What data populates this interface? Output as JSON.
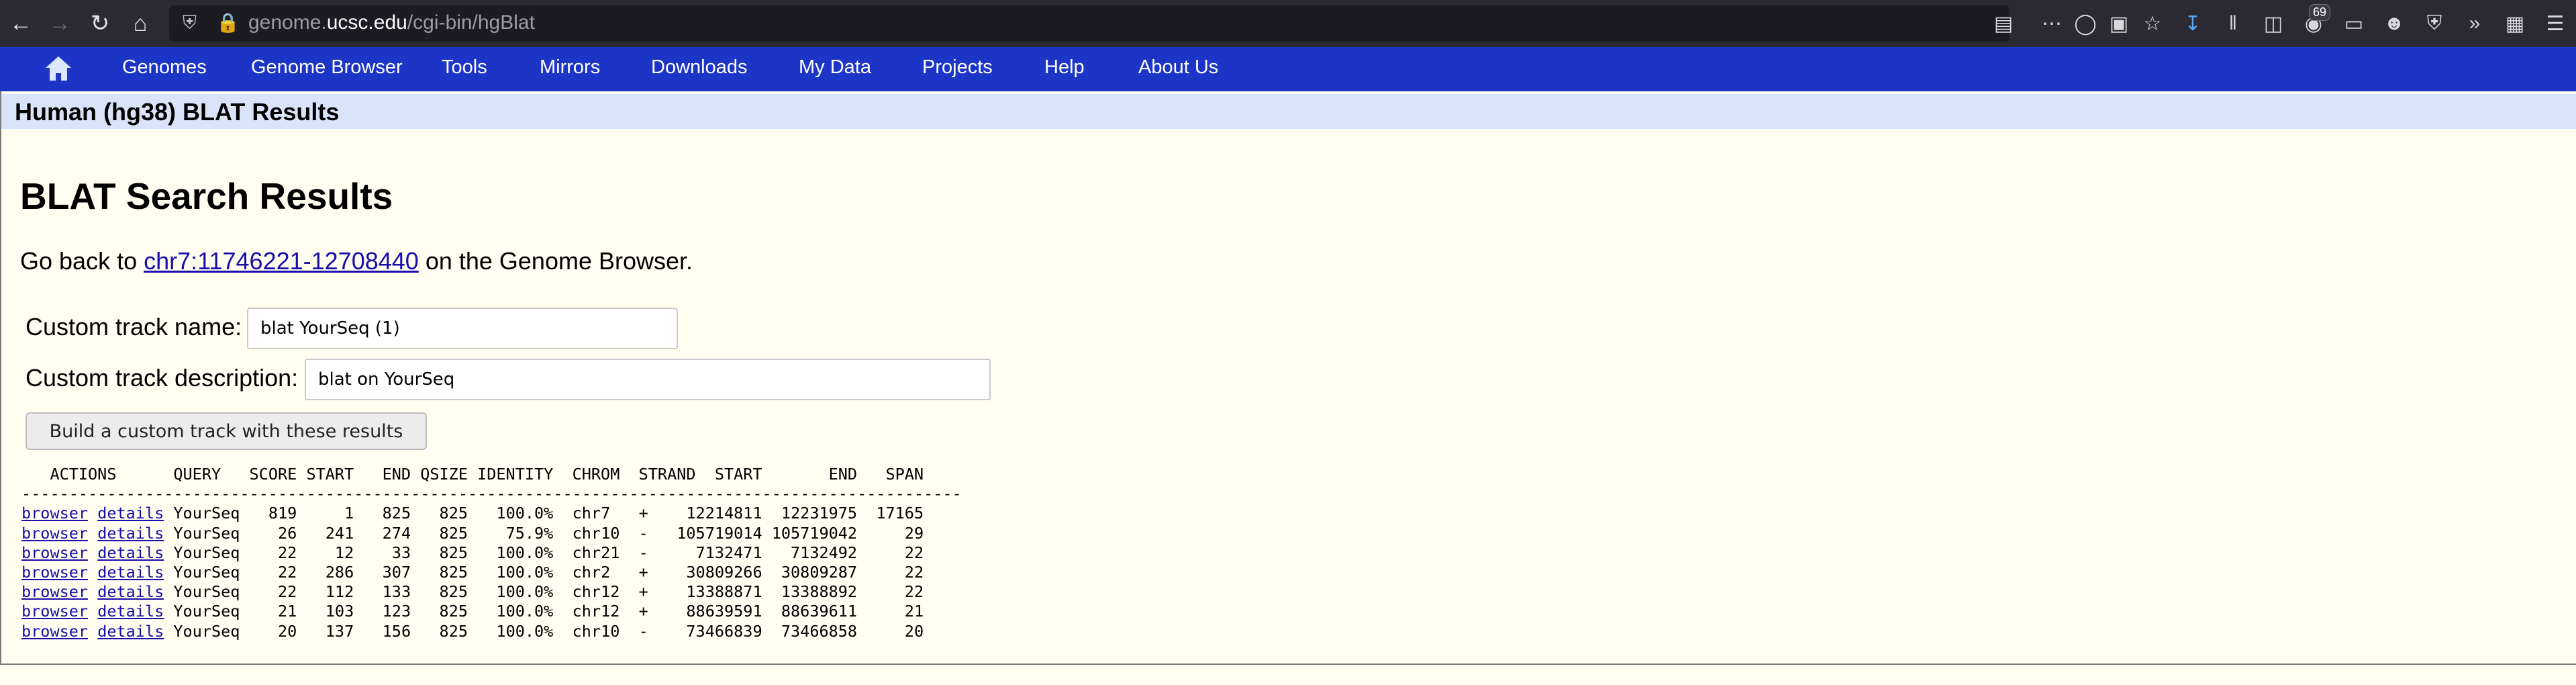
{
  "browser": {
    "url_prefix": "genome.",
    "url_domain": "ucsc.edu",
    "url_path": "/cgi-bin/hgBlat",
    "badge_count": "69"
  },
  "nav": {
    "items": [
      "Genomes",
      "Genome Browser",
      "Tools",
      "Mirrors",
      "Downloads",
      "My Data",
      "Projects",
      "Help",
      "About Us"
    ]
  },
  "page": {
    "title": "Human (hg38) BLAT Results",
    "heading": "BLAT Search Results",
    "goback_pre": "Go back to ",
    "goback_link": "chr7:11746221-12708440",
    "goback_post": " on the Genome Browser."
  },
  "form": {
    "track_name_label": "Custom track name:",
    "track_name_value": "blat YourSeq (1)",
    "track_desc_label": "Custom track description:",
    "track_desc_value": "blat on YourSeq",
    "build_button": "Build a custom track with these results"
  },
  "results": {
    "header": "   ACTIONS      QUERY   SCORE START   END QSIZE IDENTITY  CHROM  STRAND  START       END   SPAN",
    "separator": "---------------------------------------------------------------------------------------------------",
    "link_browser": "browser",
    "link_details": "details",
    "rows": [
      " YourSeq   819     1   825   825   100.0%  chr7   +    12214811  12231975  17165",
      " YourSeq    26   241   274   825    75.9%  chr10  -   105719014 105719042     29",
      " YourSeq    22    12    33   825   100.0%  chr21  -     7132471   7132492     22",
      " YourSeq    22   286   307   825   100.0%  chr2   +    30809266  30809287     22",
      " YourSeq    22   112   133   825   100.0%  chr12  +    13388871  13388892     22",
      " YourSeq    21   103   123   825   100.0%  chr12  +    88639591  88639611     21",
      " YourSeq    20   137   156   825   100.0%  chr10  -    73466839  73466858     20"
    ]
  }
}
